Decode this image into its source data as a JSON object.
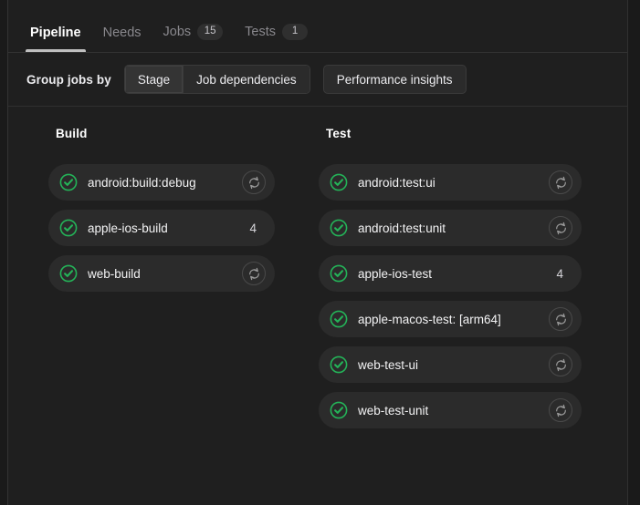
{
  "colors": {
    "page_background": "#1f1f1f",
    "card_background": "#2b2b2b",
    "status_success": "#24b358",
    "text_primary": "#ffffff",
    "text_muted": "#89888d",
    "active_tab_underline": "#bfbfbf"
  },
  "tabs": [
    {
      "label": "Pipeline",
      "badge": null,
      "active": true
    },
    {
      "label": "Needs",
      "badge": null,
      "active": false
    },
    {
      "label": "Jobs",
      "badge": "15",
      "active": false
    },
    {
      "label": "Tests",
      "badge": "1",
      "active": false
    }
  ],
  "toolbar": {
    "group_label": "Group jobs by",
    "segments": [
      {
        "label": "Stage",
        "selected": true
      },
      {
        "label": "Job dependencies",
        "selected": false
      }
    ],
    "performance_button": "Performance insights"
  },
  "graph": {
    "columns": [
      {
        "title": "Build",
        "jobs": [
          {
            "name": "android:build:debug",
            "status": "passed",
            "status_icon": "status-success-icon",
            "action": "retry",
            "action_icon": "retry-icon",
            "count": null
          },
          {
            "name": "apple-ios-build",
            "status": "passed",
            "status_icon": "status-success-icon",
            "action": "count",
            "action_icon": null,
            "count": "4"
          },
          {
            "name": "web-build",
            "status": "passed",
            "status_icon": "status-success-icon",
            "action": "retry",
            "action_icon": "retry-icon",
            "count": null
          }
        ]
      },
      {
        "title": "Test",
        "jobs": [
          {
            "name": "android:test:ui",
            "status": "passed",
            "status_icon": "status-success-icon",
            "action": "retry",
            "action_icon": "retry-icon",
            "count": null
          },
          {
            "name": "android:test:unit",
            "status": "passed",
            "status_icon": "status-success-icon",
            "action": "retry",
            "action_icon": "retry-icon",
            "count": null
          },
          {
            "name": "apple-ios-test",
            "status": "passed",
            "status_icon": "status-success-icon",
            "action": "count",
            "action_icon": null,
            "count": "4"
          },
          {
            "name": "apple-macos-test: [arm64]",
            "status": "passed",
            "status_icon": "status-success-icon",
            "action": "retry",
            "action_icon": "retry-icon",
            "count": null
          },
          {
            "name": "web-test-ui",
            "status": "passed",
            "status_icon": "status-success-icon",
            "action": "retry",
            "action_icon": "retry-icon",
            "count": null
          },
          {
            "name": "web-test-unit",
            "status": "passed",
            "status_icon": "status-success-icon",
            "action": "retry",
            "action_icon": "retry-icon",
            "count": null
          }
        ]
      }
    ]
  }
}
